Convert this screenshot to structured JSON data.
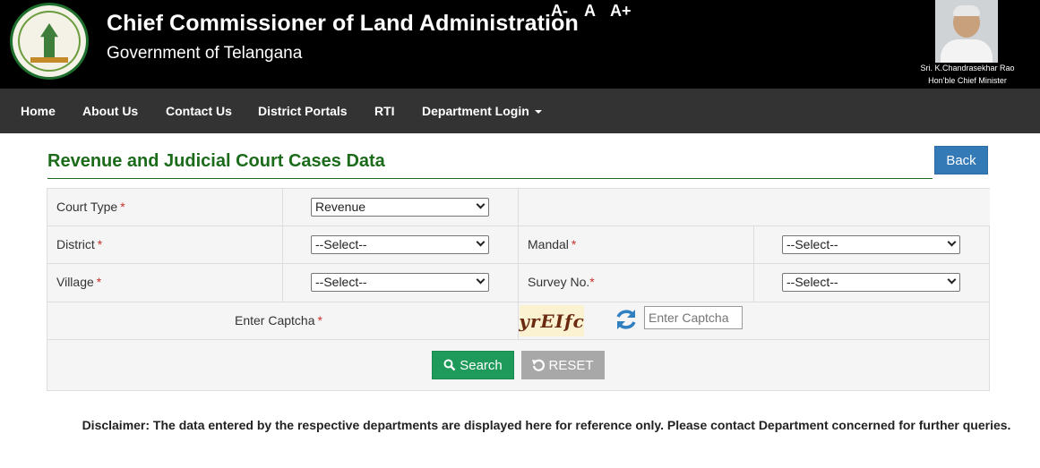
{
  "header": {
    "title": "Chief Commissioner of Land Administration",
    "subtitle": "Government of Telangana",
    "font_controls": [
      "A-",
      "A",
      "A+"
    ],
    "cm_name": "Sri. K.Chandrasekhar Rao",
    "cm_role": "Hon'ble Chief Minister",
    "emblem_icon": "telangana-emblem-icon"
  },
  "nav": {
    "items": [
      "Home",
      "About Us",
      "Contact Us",
      "District Portals",
      "RTI",
      "Department Login"
    ]
  },
  "page": {
    "title": "Revenue and Judicial Court Cases Data",
    "back_label": "Back"
  },
  "form": {
    "court_type_label": "Court Type",
    "court_type_value": "Revenue",
    "district_label": "District",
    "district_value": "--Select--",
    "mandal_label": "Mandal",
    "mandal_value": "--Select--",
    "village_label": "Village",
    "village_value": "--Select--",
    "survey_label": "Survey No.",
    "survey_value": "--Select--",
    "captcha_label": "Enter Captcha",
    "captcha_text": "yrEIfc",
    "captcha_placeholder": "Enter Captcha",
    "required_mark": "*",
    "search_label": "Search",
    "reset_label": "RESET"
  },
  "disclaimer": "Disclaimer: The data entered by the respective departments are displayed here for reference only. Please contact Department concerned for further queries.",
  "colors": {
    "header_bg": "#000000",
    "nav_bg": "#333333",
    "title_green": "#1b6b1b",
    "back_blue": "#337ab7",
    "search_green": "#1e9a5a",
    "reset_gray": "#a8a8a8",
    "required_red": "#c9302c"
  }
}
